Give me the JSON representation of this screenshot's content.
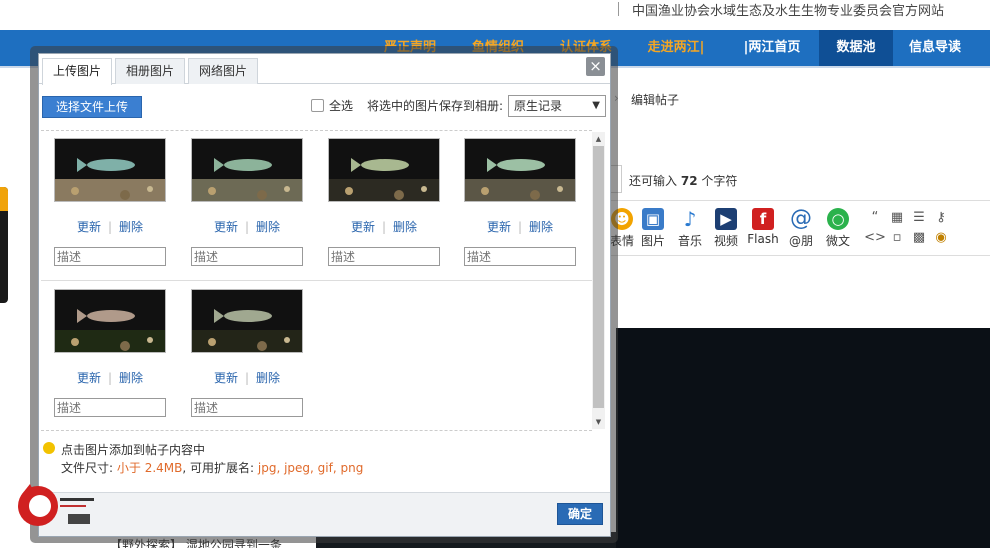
{
  "site": {
    "slogan": "中国渔业协会水域生态及水生生物专业委员会官方网站",
    "nav_items": [
      "严正声明",
      "鱼情组织",
      "认证体系",
      "走进两江|",
      "|两江首页",
      "数据池",
      "信息导读"
    ]
  },
  "editor": {
    "crumb_current": "编辑帖子",
    "remain_prefix": "还可输入",
    "remain_count": "72",
    "remain_suffix": "个字符",
    "tools": [
      {
        "label": "表情",
        "icon": "smile-icon",
        "color": "#f2a300"
      },
      {
        "label": "图片",
        "icon": "image-icon",
        "color": "#3a7bc8"
      },
      {
        "label": "音乐",
        "icon": "music-icon",
        "color": "#2a7ad0"
      },
      {
        "label": "视频",
        "icon": "video-icon",
        "color": "#1d3f73"
      },
      {
        "label": "Flash",
        "icon": "flash-icon",
        "color": "#d02020"
      },
      {
        "label": "@朋",
        "icon": "at-icon",
        "color": "#2a6bb5"
      },
      {
        "label": "微文",
        "icon": "wechat-icon",
        "color": "#2bb24c"
      }
    ],
    "bottom_topic": "【野外探索】 湿地公园寻到一条"
  },
  "dialog": {
    "tabs": [
      "上传图片",
      "相册图片",
      "网络图片"
    ],
    "close_label": "×",
    "upload_button": "选择文件上传",
    "select_all": "全选",
    "save_to_album_label": "将选中的图片保存到相册:",
    "album_selected": "原生记录",
    "photos": [
      {
        "update": "更新",
        "delete": "删除",
        "desc_placeholder": "描述",
        "bg": "#8a7a60",
        "fish": "#7fb0a8"
      },
      {
        "update": "更新",
        "delete": "删除",
        "desc_placeholder": "描述",
        "bg": "#6d6a55",
        "fish": "#8cb39a"
      },
      {
        "update": "更新",
        "delete": "删除",
        "desc_placeholder": "描述",
        "bg": "#2c2a22",
        "fish": "#a8b890"
      },
      {
        "update": "更新",
        "delete": "删除",
        "desc_placeholder": "描述",
        "bg": "#5b5646",
        "fish": "#9cc0a4"
      },
      {
        "update": "更新",
        "delete": "删除",
        "desc_placeholder": "描述",
        "bg": "#1f2a14",
        "fish": "#b09a8a"
      },
      {
        "update": "更新",
        "delete": "删除",
        "desc_placeholder": "描述",
        "bg": "#232518",
        "fish": "#a0a890"
      }
    ],
    "tip": "点击图片添加到帖子内容中",
    "size_prefix": "文件尺寸:",
    "size_value": "小于 2.4MB",
    "ext_prefix": ", 可用扩展名:",
    "ext_value": "jpg, jpeg, gif, png",
    "ok_button": "确定"
  },
  "colors": {
    "nav_blue": "#1e6fc0",
    "button_blue": "#3b7fd1",
    "highlight_orange": "#e06a2b",
    "link_blue": "#2a65ad"
  }
}
